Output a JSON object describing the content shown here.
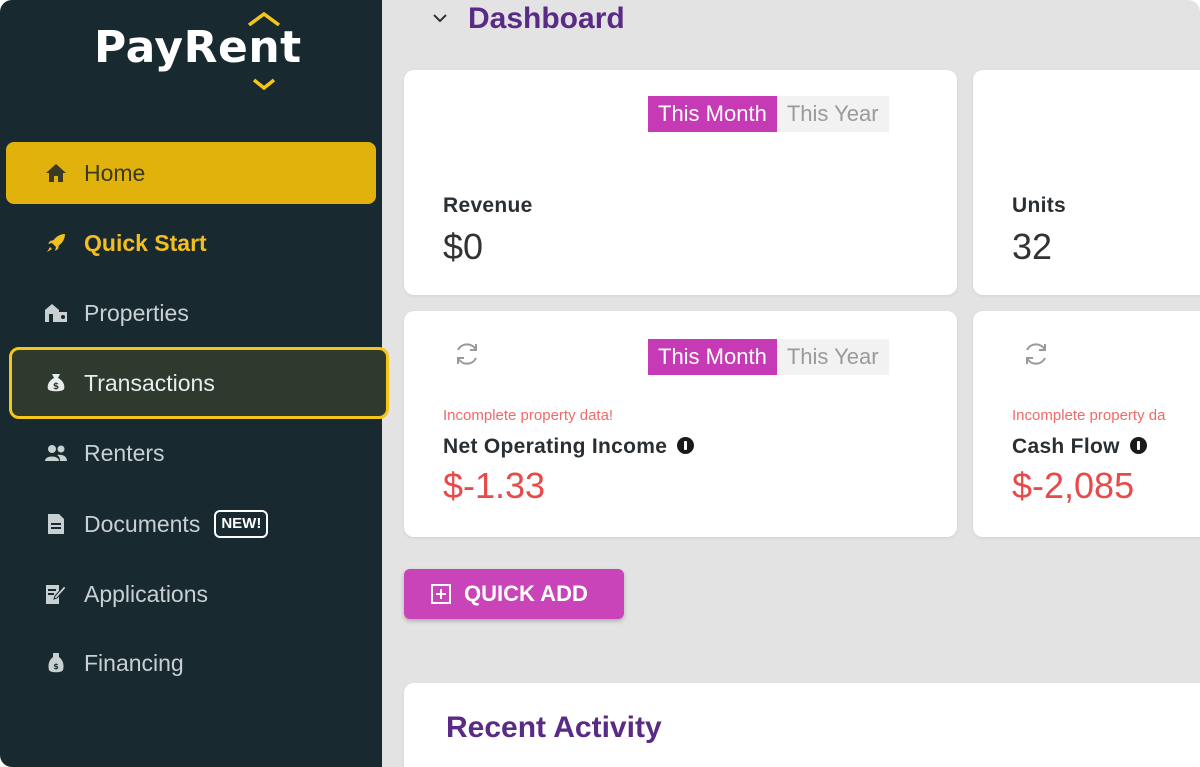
{
  "brand": {
    "logo_prefix": "PayRe",
    "logo_n": "n",
    "logo_suffix": "t",
    "logo_color": "#ffffff",
    "accent_yellow": "#f5c518"
  },
  "sidebar": {
    "background": "#18292f",
    "items": [
      {
        "label": "Home",
        "icon": "home-icon"
      },
      {
        "label": "Quick Start",
        "icon": "rocket-icon"
      },
      {
        "label": "Properties",
        "icon": "properties-icon"
      },
      {
        "label": "Transactions",
        "icon": "money-bag-icon"
      },
      {
        "label": "Renters",
        "icon": "users-icon"
      },
      {
        "label": "Documents",
        "icon": "document-icon",
        "badge": "NEW!"
      },
      {
        "label": "Applications",
        "icon": "application-edit-icon"
      },
      {
        "label": "Financing",
        "icon": "financing-bag-icon"
      }
    ]
  },
  "main": {
    "title": "Dashboard",
    "period_toggle": {
      "this_month": "This Month",
      "this_year": "This Year"
    },
    "cards": {
      "revenue": {
        "label": "Revenue",
        "value": "$0"
      },
      "units": {
        "label": "Units",
        "value": "32"
      },
      "noi": {
        "warning": "Incomplete property data!",
        "label": "Net Operating Income",
        "value": "$-1.33"
      },
      "cash_flow": {
        "warning": "Incomplete property da",
        "label": "Cash Flow",
        "value": "$-2,085"
      }
    },
    "quick_add_label": "QUICK ADD",
    "recent_activity_title": "Recent Activity"
  },
  "colors": {
    "primary_purple": "#5a2a87",
    "toggle_active": "#c63bb5",
    "negative_red": "#e84a4a",
    "home_active_bg": "#e0b20b"
  }
}
